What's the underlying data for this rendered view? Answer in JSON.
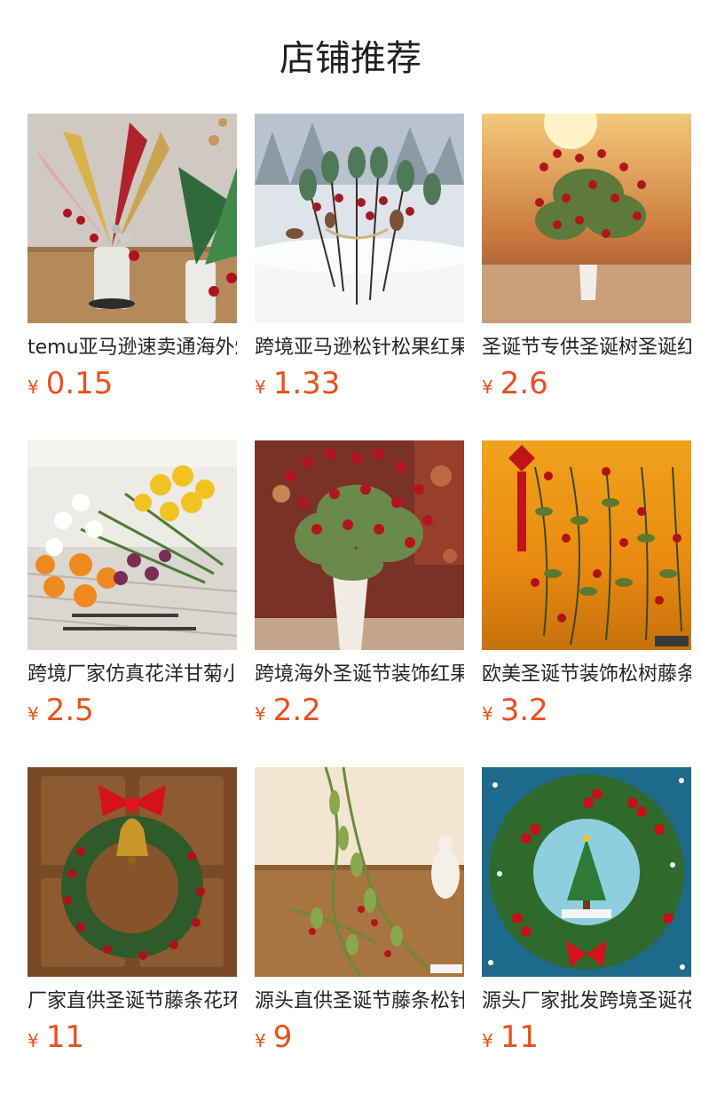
{
  "page_title": "店铺推荐",
  "currency_symbol": "¥",
  "products": [
    {
      "name": "temu亚马逊速卖通海外爆款圣诞",
      "price": "0.15",
      "image": "christmas-spray-vase-image"
    },
    {
      "name": "跨境亚马逊松针松果红果圣诞插",
      "price": "1.33",
      "image": "pine-picks-in-snow-image"
    },
    {
      "name": "圣诞节专供圣诞树圣诞红果插花",
      "price": "2.6",
      "image": "red-berry-vase-sunset-image"
    },
    {
      "name": "跨境厂家仿真花洋甘菊小雏菊",
      "price": "2.5",
      "image": "daisy-bouquet-image"
    },
    {
      "name": "跨境海外圣诞节装饰红果插花",
      "price": "2.2",
      "image": "red-berry-vase-indoor-image"
    },
    {
      "name": "欧美圣诞节装饰松树藤条挂件",
      "price": "3.2",
      "image": "hanging-berry-vine-image"
    },
    {
      "name": "厂家直供圣诞节藤条花环铃铛",
      "price": "11",
      "image": "bell-wreath-on-door-image"
    },
    {
      "name": "源头直供圣诞节藤条松针挂件",
      "price": "9",
      "image": "pine-garland-on-table-image"
    },
    {
      "name": "源头厂家批发跨境圣诞花环装饰",
      "price": "11",
      "image": "wreath-with-tree-image"
    }
  ]
}
